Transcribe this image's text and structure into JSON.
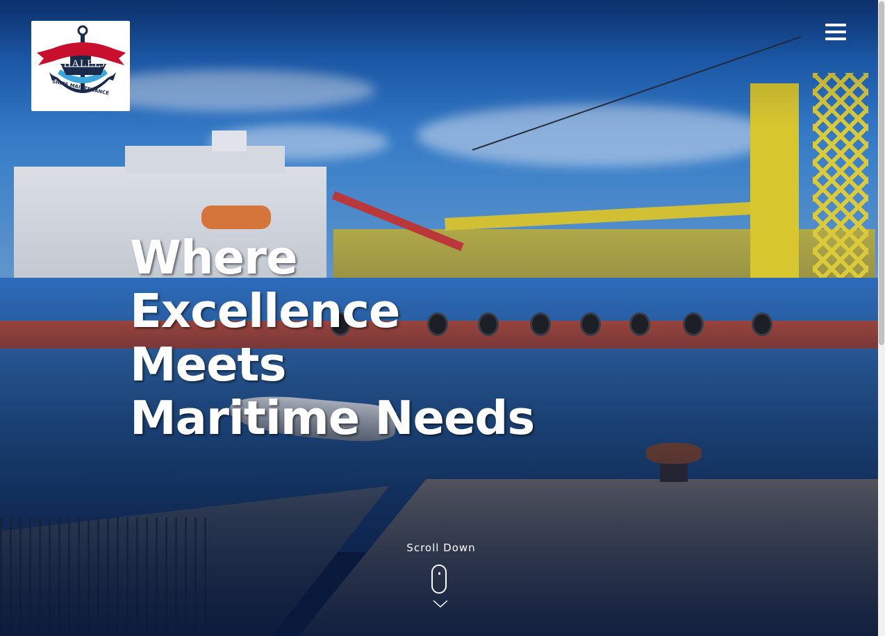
{
  "header": {
    "logo": {
      "brand_name": "KHALEEJ",
      "tagline": "SHIPS MAINTENANCE",
      "icon": "anchor-ship-logo"
    },
    "menu_icon": "hamburger-menu-icon"
  },
  "hero": {
    "headline_lines": [
      "Where",
      "Excellence",
      "Meets",
      "Maritime Needs"
    ],
    "scroll_label": "Scroll Down",
    "scroll_icon": "mouse-icon",
    "scroll_arrow_icon": "chevron-down-icon"
  },
  "colors": {
    "text": "#ffffff",
    "logo_red": "#c8102e",
    "logo_navy": "#1b2a4a",
    "overlay_navy": "#08183c"
  }
}
